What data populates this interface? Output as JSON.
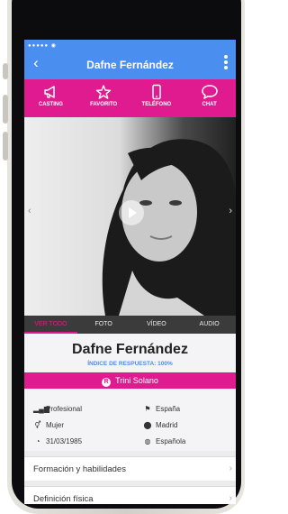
{
  "nav": {
    "title": "Dafne Fernández",
    "status": "●●●●● ◉"
  },
  "actions": [
    {
      "label": "CASTING",
      "icon": "megaphone-icon"
    },
    {
      "label": "FAVORITO",
      "icon": "star-icon"
    },
    {
      "label": "TELÉFONO",
      "icon": "phone-icon"
    },
    {
      "label": "CHAT",
      "icon": "chat-bubble-icon"
    }
  ],
  "media_tabs": [
    {
      "label": "VER TODO",
      "active": true
    },
    {
      "label": "FOTO",
      "active": false
    },
    {
      "label": "VÍDEO",
      "active": false
    },
    {
      "label": "AUDIO",
      "active": false
    }
  ],
  "carousel": {
    "pages": 3,
    "current": 1
  },
  "profile": {
    "name": "Dafne Fernández",
    "response_index": "ÍNDICE DE RESPUESTA: 100%",
    "agent_badge": "R",
    "agent": "Trini Solano",
    "profession": "Profesional",
    "gender": "Mujer",
    "birthdate": "31/03/1985",
    "country": "España",
    "city": "Madrid",
    "nationality": "Española"
  },
  "sections": [
    {
      "label": "Formación y habilidades"
    },
    {
      "label": "Definición física"
    }
  ],
  "colors": {
    "blue": "#4a8ef0",
    "magenta": "#e01a8f",
    "dark": "#3b3b3b"
  }
}
